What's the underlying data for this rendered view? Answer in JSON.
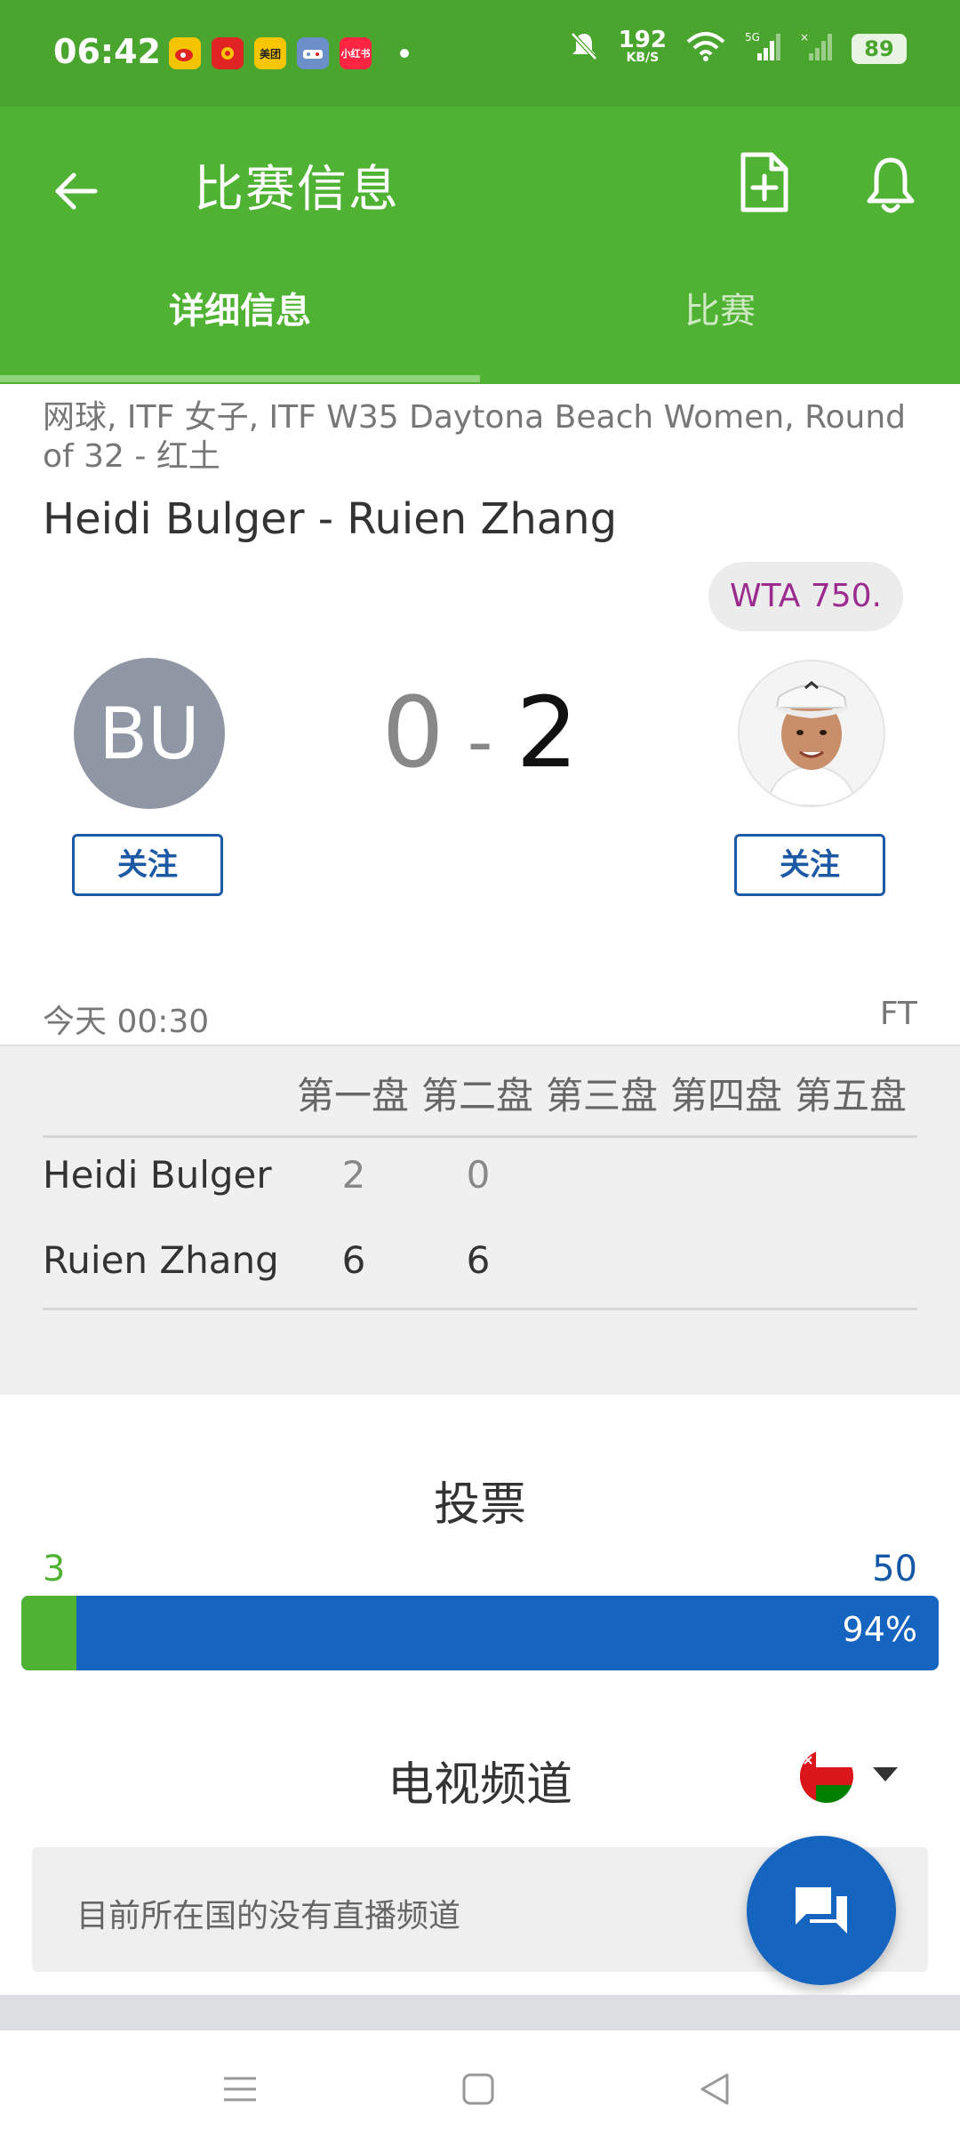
{
  "status_bar": {
    "time": "06:42",
    "app_icons": [
      {
        "name": "weibo-icon",
        "label": "",
        "color": "#f5c400"
      },
      {
        "name": "red-app-icon",
        "label": "",
        "color": "#e02424"
      },
      {
        "name": "meituan-icon",
        "label": "美团",
        "color": "#f7c600"
      },
      {
        "name": "game-app-icon",
        "label": "",
        "color": "#6a8fc9"
      },
      {
        "name": "xiaohongshu-icon",
        "label": "小红书",
        "color": "#ff2442"
      }
    ],
    "net_speed_value": "192",
    "net_speed_unit": "KB/S",
    "battery": "89"
  },
  "app_bar": {
    "title": "比赛信息",
    "tabs": [
      {
        "label": "详细信息",
        "active": true
      },
      {
        "label": "比赛",
        "active": false
      }
    ],
    "colors": {
      "primary": "#4fb233",
      "status": "#4aa52e"
    }
  },
  "match": {
    "competition": "网球, ITF 女子, ITF W35 Daytona Beach Women, Round of 32 - 红土",
    "title": "Heidi Bulger - Ruien Zhang",
    "tier_badge": "WTA 750.",
    "home_initials": "BU",
    "home_score": "0",
    "score_separator": "-",
    "away_score": "2",
    "follow_label": "关注",
    "time": "今天 00:30",
    "status": "FT"
  },
  "sets": {
    "headers": [
      "第一盘",
      "第二盘",
      "第三盘",
      "第四盘",
      "第五盘"
    ],
    "rows": [
      {
        "player": "Heidi Bulger",
        "scores": [
          "2",
          "0"
        ]
      },
      {
        "player": "Ruien Zhang",
        "scores": [
          "6",
          "6"
        ]
      }
    ]
  },
  "vote": {
    "title": "投票",
    "home_votes": "3",
    "away_votes": "50",
    "away_percent": "94%",
    "home_fraction": 0.06
  },
  "tv": {
    "title": "电视频道",
    "empty_message": "目前所在国的没有直播频道"
  }
}
